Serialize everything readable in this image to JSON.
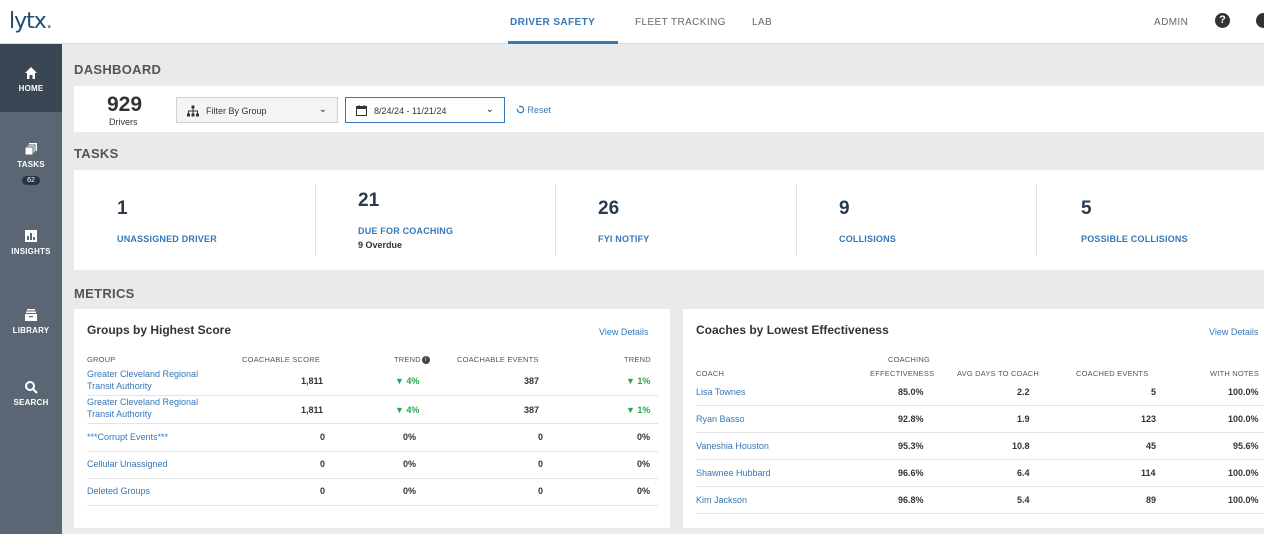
{
  "app": {
    "logo": "lytx",
    "logo_dot": "."
  },
  "topnav": {
    "tabs": [
      {
        "label": "DRIVER SAFETY",
        "active": true
      },
      {
        "label": "FLEET TRACKING",
        "active": false
      },
      {
        "label": "LAB",
        "active": false
      }
    ],
    "user_label": "ADMIN"
  },
  "sidebar": {
    "items": [
      {
        "label": "HOME",
        "icon": "home-icon"
      },
      {
        "label": "TASKS",
        "icon": "tasks-icon",
        "badge": "62"
      },
      {
        "label": "INSIGHTS",
        "icon": "insights-icon"
      },
      {
        "label": "LIBRARY",
        "icon": "library-icon"
      },
      {
        "label": "SEARCH",
        "icon": "search-icon"
      }
    ]
  },
  "dashboard": {
    "title": "DASHBOARD",
    "drivers_count": "929",
    "drivers_label": "Drivers",
    "group_filter": "Filter By Group",
    "date_range": "8/24/24 - 11/21/24",
    "reset_label": "Reset"
  },
  "tasks": {
    "title": "TASKS",
    "items": [
      {
        "count": "1",
        "label": "UNASSIGNED DRIVER",
        "sub": ""
      },
      {
        "count": "21",
        "label": "DUE FOR COACHING",
        "sub": "9 Overdue"
      },
      {
        "count": "26",
        "label": "FYI NOTIFY",
        "sub": ""
      },
      {
        "count": "9",
        "label": "COLLISIONS",
        "sub": ""
      },
      {
        "count": "5",
        "label": "POSSIBLE COLLISIONS",
        "sub": ""
      }
    ]
  },
  "metrics": {
    "title": "METRICS",
    "groups": {
      "title": "Groups by Highest Score",
      "view_details": "View Details",
      "headers": [
        "GROUP",
        "COACHABLE SCORE",
        "TREND",
        "COACHABLE EVENTS",
        "TREND"
      ],
      "rows": [
        {
          "group": [
            "Greater Cleveland Regional",
            "Transit Authority"
          ],
          "score": "1,811",
          "trend1": "▼ 4%",
          "events": "387",
          "trend2": "▼ 1%",
          "green": true
        },
        {
          "group": [
            "Greater Cleveland Regional",
            "Transit Authority"
          ],
          "score": "1,811",
          "trend1": "▼ 4%",
          "events": "387",
          "trend2": "▼ 1%",
          "green": true
        },
        {
          "group": [
            "***Corrupt Events***"
          ],
          "score": "0",
          "trend1": "0%",
          "events": "0",
          "trend2": "0%",
          "green": false
        },
        {
          "group": [
            "Cellular Unassigned"
          ],
          "score": "0",
          "trend1": "0%",
          "events": "0",
          "trend2": "0%",
          "green": false
        },
        {
          "group": [
            "Deleted Groups"
          ],
          "score": "0",
          "trend1": "0%",
          "events": "0",
          "trend2": "0%",
          "green": false
        }
      ]
    },
    "coaches": {
      "title": "Coaches by Lowest Effectiveness",
      "view_details": "View Details",
      "headers": {
        "coach": "COACH",
        "eff_line1": "COACHING",
        "eff_line2": "EFFECTIVENESS",
        "avg": "AVG DAYS TO COACH",
        "coached": "COACHED EVENTS",
        "notes": "WITH NOTES"
      },
      "rows": [
        {
          "coach": "Lisa Townes",
          "eff": "85.0%",
          "avg": "2.2",
          "coached": "5",
          "notes": "100.0%"
        },
        {
          "coach": "Ryan Basso",
          "eff": "92.8%",
          "avg": "1.9",
          "coached": "123",
          "notes": "100.0%"
        },
        {
          "coach": "Vaneshia Houston",
          "eff": "95.3%",
          "avg": "10.8",
          "coached": "45",
          "notes": "95.6%"
        },
        {
          "coach": "Shawnee Hubbard",
          "eff": "96.6%",
          "avg": "6.4",
          "coached": "114",
          "notes": "100.0%"
        },
        {
          "coach": "Kim Jackson",
          "eff": "96.8%",
          "avg": "5.4",
          "coached": "89",
          "notes": "100.0%"
        }
      ]
    }
  },
  "colors": {
    "accent": "#3677b6",
    "sidebar": "#5b6675",
    "sidebar_active": "#3b4654",
    "trend_good": "#2aa84a"
  }
}
